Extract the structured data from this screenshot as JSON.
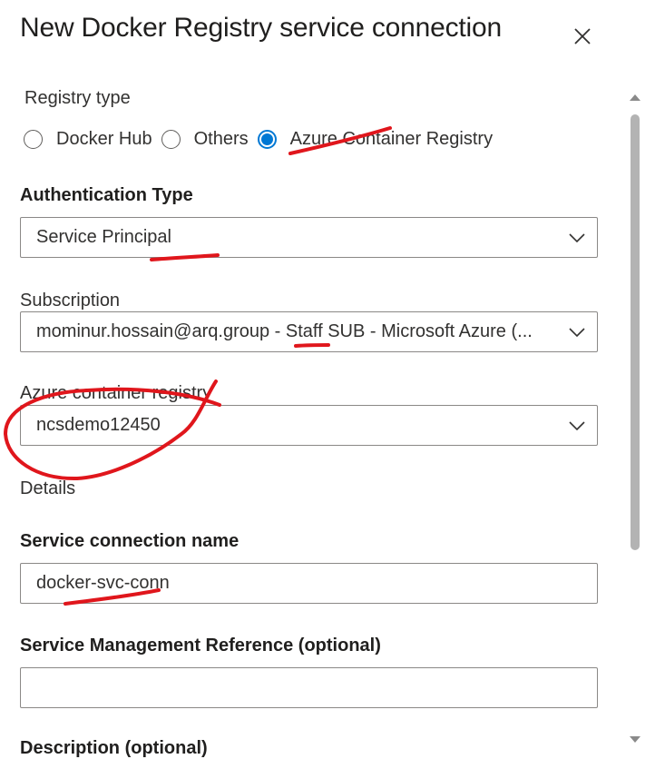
{
  "panel": {
    "title": "New Docker Registry service connection",
    "close_icon": "close-icon"
  },
  "registry_type": {
    "label": "Registry type",
    "options": [
      {
        "label": "Docker Hub",
        "checked": false
      },
      {
        "label": "Others",
        "checked": false
      },
      {
        "label": "Azure Container Registry",
        "checked": true
      }
    ]
  },
  "auth_type": {
    "label": "Authentication Type",
    "value": "Service Principal"
  },
  "subscription": {
    "label": "Subscription",
    "value": "mominur.hossain@arq.group - Staff SUB - Microsoft Azure (..."
  },
  "acr": {
    "label": "Azure container registry",
    "value": "ncsdemo12450"
  },
  "details": {
    "label": "Details"
  },
  "service_connection_name": {
    "label": "Service connection name",
    "value": "docker-svc-conn"
  },
  "service_management_reference": {
    "label": "Service Management Reference (optional)",
    "value": ""
  },
  "description": {
    "label": "Description (optional)"
  },
  "colors": {
    "accent": "#0078d4",
    "annotation": "#e0161c"
  }
}
